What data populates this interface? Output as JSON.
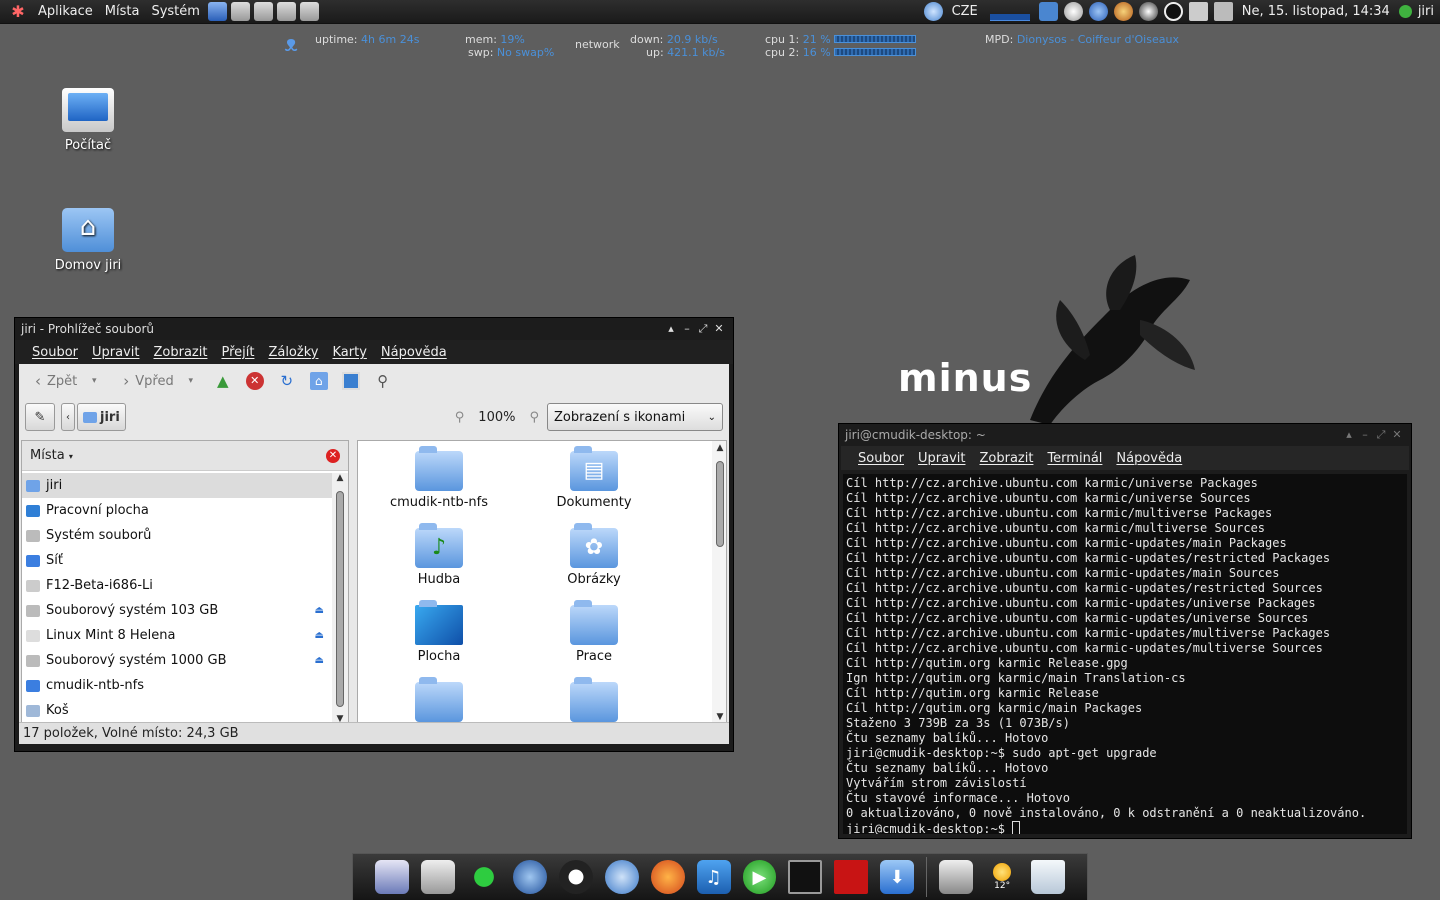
{
  "top_panel": {
    "menus": [
      "Aplikace",
      "Místa",
      "Systém"
    ],
    "keyboard_layout": "CZE",
    "datetime": "Ne, 15. listopad, 14:34",
    "user": "jiri"
  },
  "conky": {
    "uptime_label": "uptime:",
    "uptime_value": "4h 6m 24s",
    "mem_label": "mem:",
    "mem_value": "19%",
    "swp_label": "swp:",
    "swp_value": "No swap%",
    "network_label": "network",
    "down_label": "down:",
    "down_value": "20.9 kb/s",
    "up_label": "up:",
    "up_value": "421.1 kb/s",
    "cpu1_label": "cpu 1:",
    "cpu1_value": "21 %",
    "cpu2_label": "cpu 2:",
    "cpu2_value": "16 %",
    "mpd_label": "MPD:",
    "mpd_value": "Dionysos - Coiffeur d'Oiseaux"
  },
  "desktop": {
    "icons": [
      {
        "label": "Počítač"
      },
      {
        "label": "Domov jiri"
      }
    ],
    "wallpaper_text": "minus"
  },
  "nautilus": {
    "title": "jiri - Prohlížeč souborů",
    "menus": [
      "Soubor",
      "Upravit",
      "Zobrazit",
      "Přejít",
      "Záložky",
      "Karty",
      "Nápověda"
    ],
    "toolbar": {
      "back_label": "Zpět",
      "forward_label": "Vpřed"
    },
    "location_button": "jiri",
    "zoom_level": "100%",
    "view_mode": "Zobrazení s ikonami",
    "sidebar_title": "Místa",
    "sidebar_items": [
      {
        "label": "jiri",
        "ejectable": false,
        "icon_color": "#6fa3e8"
      },
      {
        "label": "Pracovní plocha",
        "ejectable": false,
        "icon_color": "#2f7fd6"
      },
      {
        "label": "Systém souborů",
        "ejectable": false,
        "icon_color": "#bbbbbb"
      },
      {
        "label": "Síť",
        "ejectable": false,
        "icon_color": "#3b7ee0"
      },
      {
        "label": "F12-Beta-i686-Li",
        "ejectable": false,
        "icon_color": "#cccccc"
      },
      {
        "label": "Souborový systém 103 GB",
        "ejectable": true,
        "icon_color": "#bbbbbb"
      },
      {
        "label": "Linux Mint 8 Helena",
        "ejectable": true,
        "icon_color": "#dddddd"
      },
      {
        "label": "Souborový systém 1000 GB",
        "ejectable": true,
        "icon_color": "#bbbbbb"
      },
      {
        "label": "cmudik-ntb-nfs",
        "ejectable": false,
        "icon_color": "#3b7ee0"
      },
      {
        "label": "Koš",
        "ejectable": false,
        "icon_color": "#9fb8d8"
      }
    ],
    "files": [
      {
        "label": "cmudik-ntb-nfs",
        "kind": "folder"
      },
      {
        "label": "Dokumenty",
        "kind": "documents"
      },
      {
        "label": "Hudba",
        "kind": "music"
      },
      {
        "label": "Obrázky",
        "kind": "pictures"
      },
      {
        "label": "Plocha",
        "kind": "desktop"
      },
      {
        "label": "Prace",
        "kind": "folder"
      },
      {
        "label": "",
        "kind": "folder"
      },
      {
        "label": "",
        "kind": "folder"
      }
    ],
    "status": "17 položek, Volné místo: 24,3 GB"
  },
  "terminal": {
    "title": "jiri@cmudik-desktop: ~",
    "menus": [
      "Soubor",
      "Upravit",
      "Zobrazit",
      "Terminál",
      "Nápověda"
    ],
    "lines": [
      "Cíl http://cz.archive.ubuntu.com karmic/universe Packages",
      "Cíl http://cz.archive.ubuntu.com karmic/universe Sources",
      "Cíl http://cz.archive.ubuntu.com karmic/multiverse Packages",
      "Cíl http://cz.archive.ubuntu.com karmic/multiverse Sources",
      "Cíl http://cz.archive.ubuntu.com karmic-updates/main Packages",
      "Cíl http://cz.archive.ubuntu.com karmic-updates/restricted Packages",
      "Cíl http://cz.archive.ubuntu.com karmic-updates/main Sources",
      "Cíl http://cz.archive.ubuntu.com karmic-updates/restricted Sources",
      "Cíl http://cz.archive.ubuntu.com karmic-updates/universe Packages",
      "Cíl http://cz.archive.ubuntu.com karmic-updates/universe Sources",
      "Cíl http://cz.archive.ubuntu.com karmic-updates/multiverse Packages",
      "Cíl http://cz.archive.ubuntu.com karmic-updates/multiverse Sources",
      "Cíl http://qutim.org karmic Release.gpg",
      "Ign http://qutim.org karmic/main Translation-cs",
      "Cíl http://qutim.org karmic Release",
      "Cíl http://qutim.org karmic/main Packages",
      "Staženo 3 739B za 3s (1 073B/s)",
      "Čtu seznamy balíků... Hotovo",
      "jiri@cmudik-desktop:~$ sudo apt-get upgrade",
      "Čtu seznamy balíků... Hotovo",
      "Vytvářím strom závislostí",
      "Čtu stavové informace... Hotovo",
      "0 aktualizováno, 0 nově instalováno, 0 k odstranění a 0 neaktualizováno."
    ],
    "prompt": "jiri@cmudik-desktop:~$ "
  },
  "dock": {
    "weather_temp": "12°"
  },
  "colors": {
    "accent": "#4a90d9",
    "desktop_bg": "#5e5e5e",
    "panel_bg": "#1f1f1f"
  }
}
